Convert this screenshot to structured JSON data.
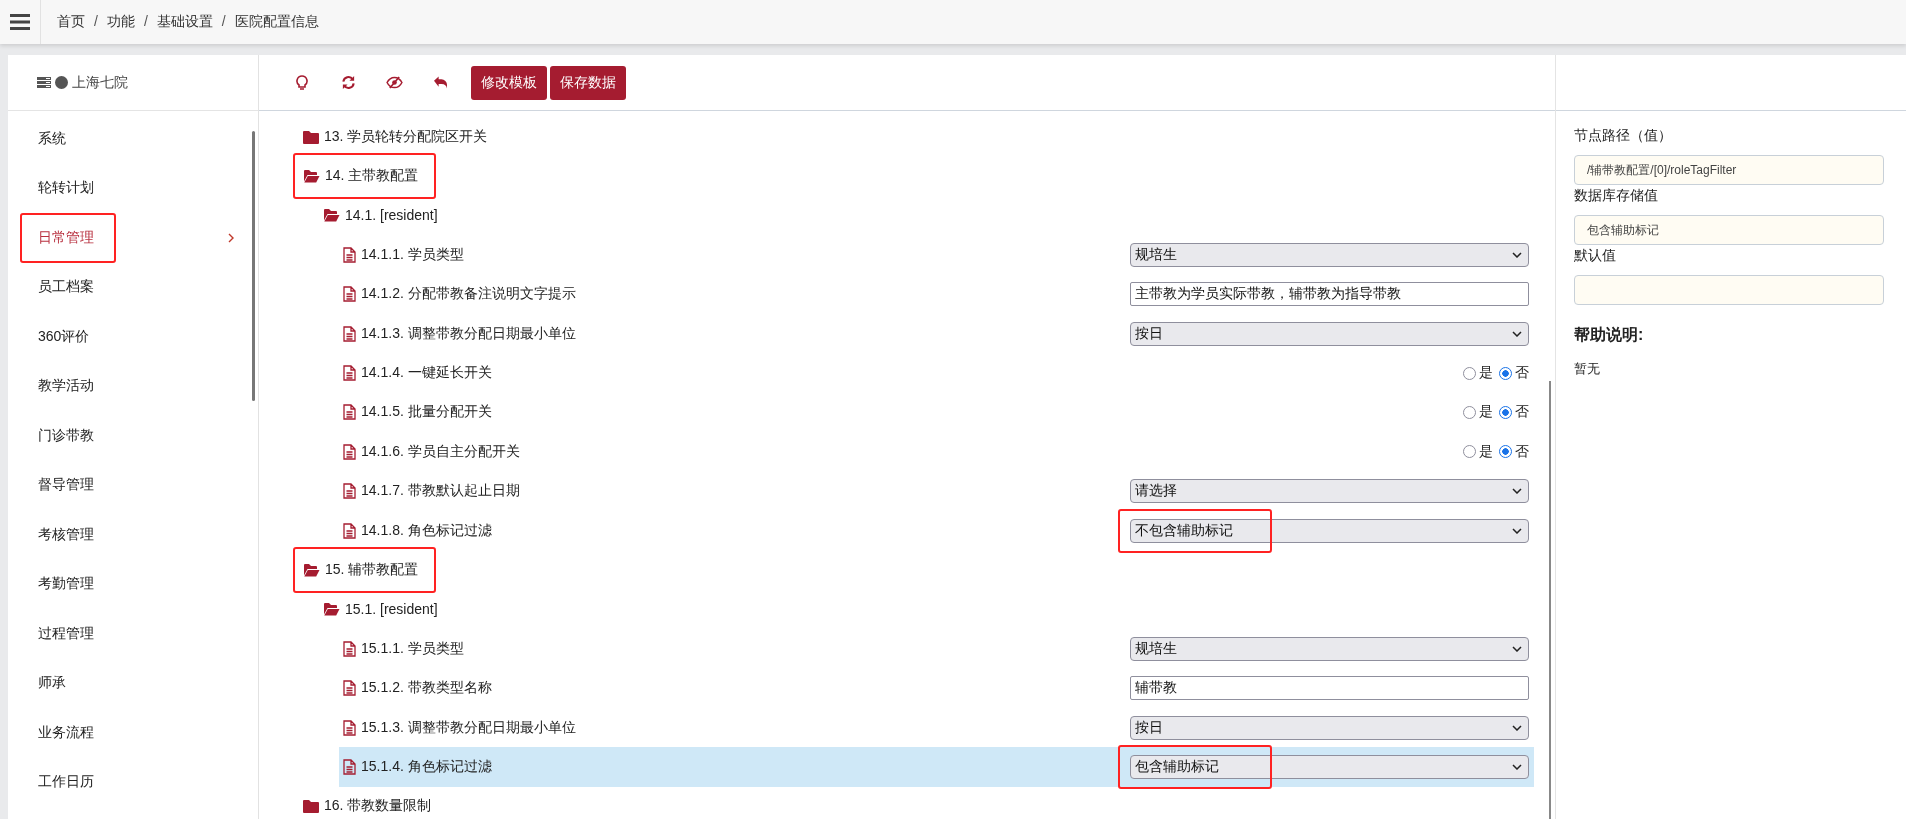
{
  "breadcrumb": [
    {
      "label": "首页"
    },
    {
      "separator": "/",
      "label": "功能"
    },
    {
      "separator": "/",
      "label": "基础设置"
    },
    {
      "separator": "/",
      "label": "医院配置信息"
    }
  ],
  "sidebar": {
    "title": "上海七院",
    "items": [
      {
        "label": "系统",
        "selected": false,
        "annotated": false
      },
      {
        "label": "轮转计划",
        "selected": false,
        "annotated": false
      },
      {
        "label": "日常管理",
        "selected": true,
        "annotated": true
      },
      {
        "label": "员工档案",
        "selected": false,
        "annotated": false
      },
      {
        "label": "360评价",
        "selected": false,
        "annotated": false
      },
      {
        "label": "教学活动",
        "selected": false,
        "annotated": false
      },
      {
        "label": "门诊带教",
        "selected": false,
        "annotated": false
      },
      {
        "label": "督导管理",
        "selected": false,
        "annotated": false
      },
      {
        "label": "考核管理",
        "selected": false,
        "annotated": false
      },
      {
        "label": "考勤管理",
        "selected": false,
        "annotated": false
      },
      {
        "label": "过程管理",
        "selected": false,
        "annotated": false
      },
      {
        "label": "师承",
        "selected": false,
        "annotated": false
      },
      {
        "label": "业务流程",
        "selected": false,
        "annotated": false
      },
      {
        "label": "工作日历",
        "selected": false,
        "annotated": false
      }
    ]
  },
  "toolbar": {
    "buttons": [
      "修改模板",
      "保存数据"
    ]
  },
  "tree": [
    {
      "kind": "folder",
      "label": "13. 学员轮转分配院区开关",
      "expanded": false,
      "selected": false,
      "annotated": false
    },
    {
      "kind": "folder",
      "label": "14. 主带教配置",
      "expanded": true,
      "selected": false,
      "annotated": true,
      "children": [
        {
          "kind": "folder",
          "label": "14.1. [resident]",
          "expanded": true,
          "selected": false,
          "annotated": false,
          "children": [
            {
              "kind": "item",
              "label": "14.1.1. 学员类型",
              "selected": false,
              "control": {
                "kind": "select",
                "value": "规培生",
                "annotated": false
              }
            },
            {
              "kind": "item",
              "label": "14.1.2. 分配带教备注说明文字提示",
              "selected": false,
              "control": {
                "kind": "text",
                "value": "主带教为学员实际带教，辅带教为指导带教",
                "annotated": false
              }
            },
            {
              "kind": "item",
              "label": "14.1.3. 调整带教分配日期最小单位",
              "selected": false,
              "control": {
                "kind": "select",
                "value": "按日",
                "annotated": false
              }
            },
            {
              "kind": "item",
              "label": "14.1.4. 一键延长开关",
              "selected": false,
              "control": {
                "kind": "radio",
                "annotated": false,
                "options": [
                  {
                    "label": "是",
                    "selected": false
                  },
                  {
                    "label": "否",
                    "selected": true
                  }
                ]
              }
            },
            {
              "kind": "item",
              "label": "14.1.5. 批量分配开关",
              "selected": false,
              "control": {
                "kind": "radio",
                "annotated": false,
                "options": [
                  {
                    "label": "是",
                    "selected": false
                  },
                  {
                    "label": "否",
                    "selected": true
                  }
                ]
              }
            },
            {
              "kind": "item",
              "label": "14.1.6. 学员自主分配开关",
              "selected": false,
              "control": {
                "kind": "radio",
                "annotated": false,
                "options": [
                  {
                    "label": "是",
                    "selected": false
                  },
                  {
                    "label": "否",
                    "selected": true
                  }
                ]
              }
            },
            {
              "kind": "item",
              "label": "14.1.7. 带教默认起止日期",
              "selected": false,
              "control": {
                "kind": "select",
                "value": "请选择",
                "annotated": false
              }
            },
            {
              "kind": "item",
              "label": "14.1.8. 角色标记过滤",
              "selected": false,
              "control": {
                "kind": "select",
                "value": "不包含辅助标记",
                "annotated": true
              }
            }
          ]
        }
      ]
    },
    {
      "kind": "folder",
      "label": "15. 辅带教配置",
      "expanded": true,
      "selected": false,
      "annotated": true,
      "children": [
        {
          "kind": "folder",
          "label": "15.1. [resident]",
          "expanded": true,
          "selected": false,
          "annotated": false,
          "children": [
            {
              "kind": "item",
              "label": "15.1.1. 学员类型",
              "selected": false,
              "control": {
                "kind": "select",
                "value": "规培生",
                "annotated": false
              }
            },
            {
              "kind": "item",
              "label": "15.1.2. 带教类型名称",
              "selected": false,
              "control": {
                "kind": "text",
                "value": "辅带教",
                "annotated": false
              }
            },
            {
              "kind": "item",
              "label": "15.1.3. 调整带教分配日期最小单位",
              "selected": false,
              "control": {
                "kind": "select",
                "value": "按日",
                "annotated": false
              }
            },
            {
              "kind": "item",
              "label": "15.1.4. 角色标记过滤",
              "selected": true,
              "control": {
                "kind": "select",
                "value": "包含辅助标记",
                "annotated": true
              }
            }
          ]
        }
      ]
    },
    {
      "kind": "folder",
      "label": "16. 带教数量限制",
      "expanded": false,
      "selected": false,
      "annotated": false
    }
  ],
  "detail": {
    "fields": [
      {
        "label": "节点路径（值）",
        "value": "/辅带教配置/[0]/roleTagFilter"
      },
      {
        "label": "数据库存储值",
        "value": "包含辅助标记"
      },
      {
        "label": "默认值"
      }
    ],
    "help_title": "帮助说明:",
    "help_text": "暂无"
  }
}
